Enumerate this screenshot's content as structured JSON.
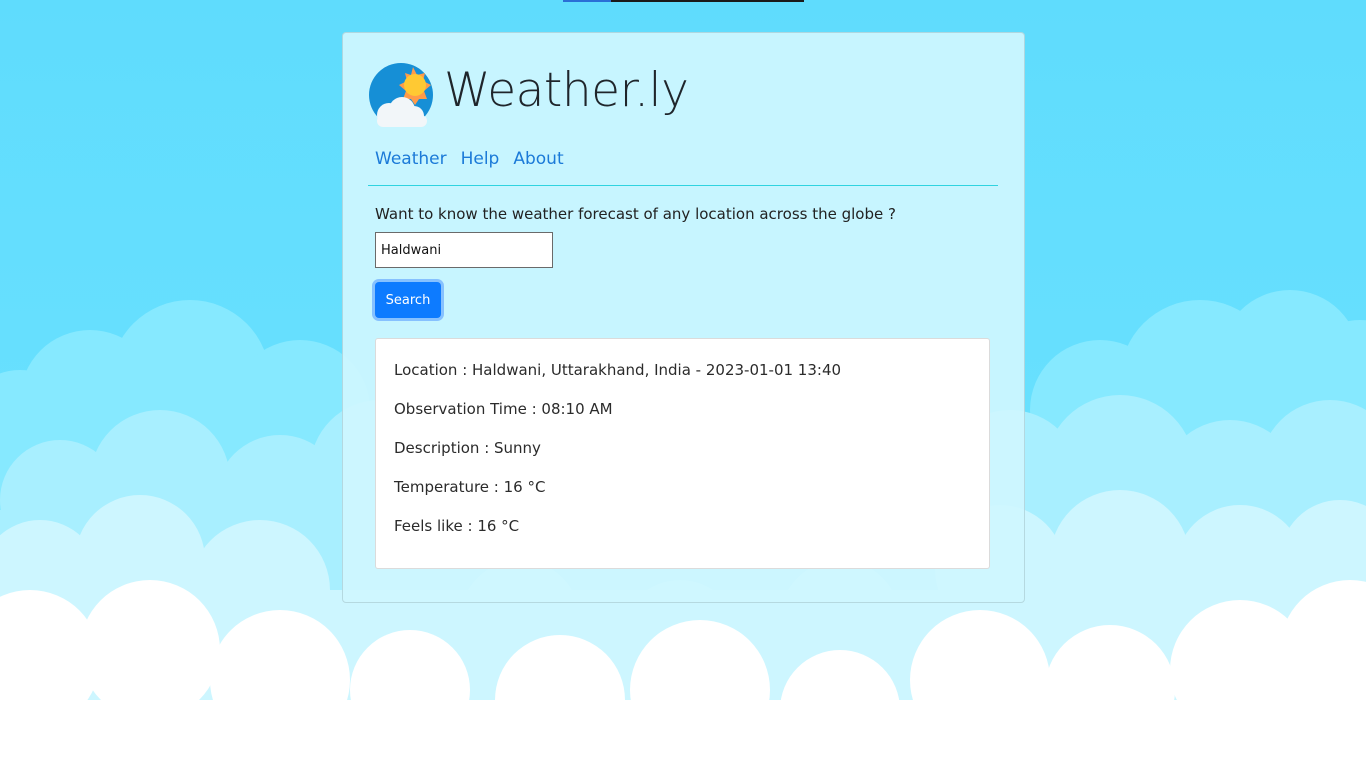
{
  "app": {
    "brand": "Weather.ly"
  },
  "nav": {
    "items": [
      {
        "label": "Weather"
      },
      {
        "label": "Help"
      },
      {
        "label": "About"
      }
    ]
  },
  "search": {
    "prompt": "Want to know the weather forecast of any location across the globe ?",
    "value": "Haldwani",
    "button_label": "Search"
  },
  "result": {
    "location": "Location : Haldwani, Uttarakhand, India - 2023-01-01 13:40",
    "observation_time": "Observation Time : 08:10 AM",
    "description": "Description : Sunny",
    "temperature": "Temperature : 16 °C",
    "feels_like": "Feels like : 16 °C"
  },
  "colors": {
    "accent": "#0d7bff",
    "link": "#1b7ad8",
    "sky": "#62dffe",
    "divider": "#2fd3e0"
  },
  "icons": {
    "logo": "sun-cloud-icon"
  }
}
